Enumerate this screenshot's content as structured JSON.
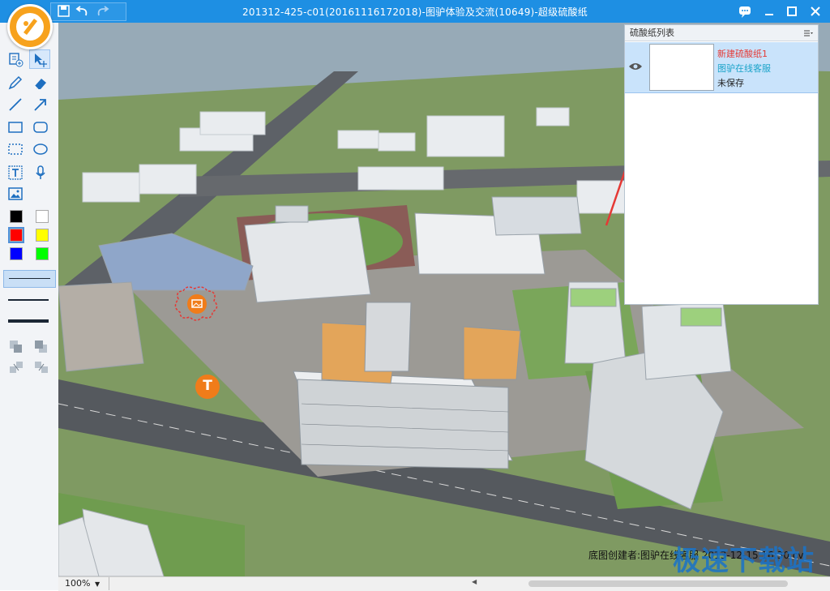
{
  "window": {
    "title": "201312-425-c01(20161116172018)-图驴体验及交流(10649)-超级硫酸纸",
    "colors": {
      "titlebar": "#1e8fe3",
      "accent_red": "#e53935",
      "marker_orange": "#f07c1a",
      "link_cyan": "#1aa3c9"
    }
  },
  "quick_access": [
    {
      "icon": "save-icon"
    },
    {
      "icon": "undo-icon"
    },
    {
      "icon": "redo-icon"
    }
  ],
  "window_buttons": [
    {
      "icon": "chat-icon"
    },
    {
      "icon": "minimize-icon"
    },
    {
      "icon": "maximize-icon"
    },
    {
      "icon": "close-icon"
    }
  ],
  "toolbar": {
    "tools": [
      {
        "icon": "add-sheet-icon"
      },
      {
        "icon": "select-move-icon",
        "selected": true
      },
      {
        "icon": "pencil-icon"
      },
      {
        "icon": "eraser-icon"
      },
      {
        "icon": "line-icon"
      },
      {
        "icon": "arrow-icon"
      },
      {
        "icon": "rectangle-icon"
      },
      {
        "icon": "rounded-rectangle-icon"
      },
      {
        "icon": "dashed-rectangle-icon"
      },
      {
        "icon": "ellipse-icon"
      },
      {
        "icon": "text-icon"
      },
      {
        "icon": "microphone-icon"
      },
      {
        "icon": "image-icon"
      }
    ],
    "colors": [
      "#000000",
      "#ffffff",
      "#ff0000",
      "#ffff00",
      "#0000ff",
      "#00ff00"
    ],
    "selected_color": "#ff0000",
    "line_widths": [
      "thin",
      "medium",
      "thick"
    ],
    "selected_line_width": "thin",
    "layer_tools": [
      {
        "icon": "bring-forward-icon"
      },
      {
        "icon": "send-backward-icon"
      },
      {
        "icon": "bring-to-front-icon"
      },
      {
        "icon": "send-to-back-icon"
      }
    ]
  },
  "panel": {
    "title": "硫酸纸列表",
    "menu_icon": "list-menu-icon",
    "items": [
      {
        "name": "新建硫酸纸1",
        "author": "图驴在线客服",
        "status": "未保存",
        "visible": true
      }
    ]
  },
  "canvas": {
    "annotations": [
      {
        "type": "image-marker",
        "icon": "image-marker-icon"
      },
      {
        "type": "text-marker",
        "label": "T"
      },
      {
        "type": "arrow",
        "color": "#e53935"
      }
    ],
    "credit": "底图创建者:图驴在线客服  2013-12-15 16:30 cv"
  },
  "statusbar": {
    "zoom": "100%"
  },
  "watermark": "极速下载站"
}
